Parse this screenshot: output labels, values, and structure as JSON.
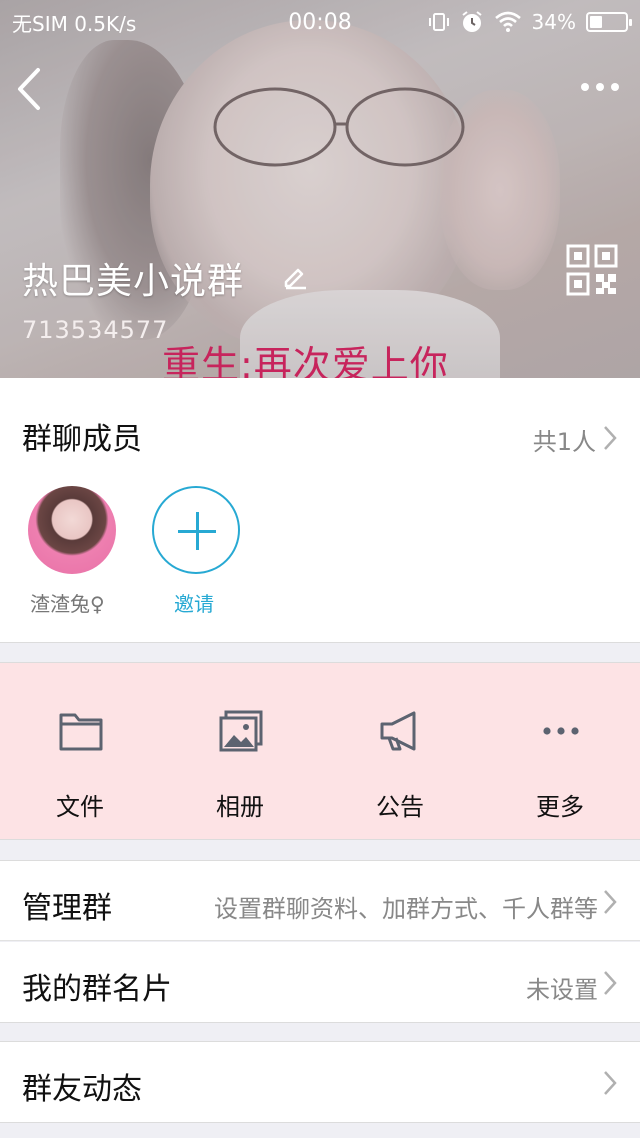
{
  "status_bar": {
    "carrier_net": "无SIM 0.5K/s",
    "time": "00:08",
    "battery_pct": "34%",
    "battery_level": 0.34,
    "icons": [
      "vibrate-icon",
      "alarm-icon",
      "wifi-icon",
      "battery-icon"
    ]
  },
  "header": {
    "group_name": "热巴美小说群",
    "group_id": "713534577",
    "cover_caption": "重生:再次爱上你",
    "icons": [
      "back-icon",
      "more-icon",
      "edit-icon",
      "qr-code-icon"
    ]
  },
  "members": {
    "title": "群聊成员",
    "count": "共1人",
    "list": [
      {
        "name": "渣渣兔♀"
      }
    ],
    "invite_label": "邀请"
  },
  "actions": [
    {
      "label": "文件",
      "icon": "folder-icon"
    },
    {
      "label": "相册",
      "icon": "album-icon"
    },
    {
      "label": "公告",
      "icon": "megaphone-icon"
    },
    {
      "label": "更多",
      "icon": "more-dots-icon"
    }
  ],
  "rows": [
    {
      "title": "管理群",
      "value": "设置群聊资料、加群方式、千人群等"
    },
    {
      "title": "我的群名片",
      "value": "未设置"
    },
    {
      "title": "群友动态",
      "value": ""
    }
  ],
  "colors": {
    "accent": "#27a9d3",
    "action_bg": "#fde3e5",
    "caption": "#c7245c",
    "icon_gray": "#5c6370"
  }
}
